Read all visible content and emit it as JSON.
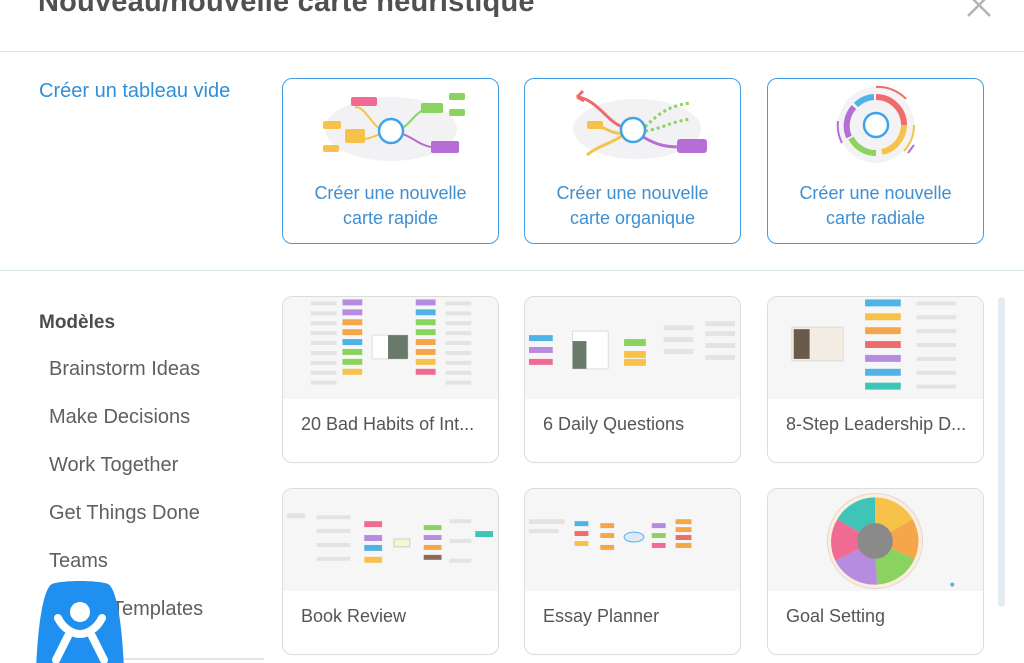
{
  "dialog": {
    "title": "Nouveau/nouvelle carte heuristique"
  },
  "create": {
    "blank_label": "Créer un tableau vide",
    "options": [
      {
        "line1": "Créer une nouvelle",
        "line2": "carte rapide"
      },
      {
        "line1": "Créer une nouvelle",
        "line2": "carte organique"
      },
      {
        "line1": "Créer une nouvelle",
        "line2": "carte radiale"
      }
    ]
  },
  "sidebar": {
    "heading": "Modèles",
    "items": [
      "Brainstorm Ideas",
      "Make Decisions",
      "Work Together",
      "Get Things Done",
      "Teams",
      "Expert Templates"
    ]
  },
  "templates": [
    {
      "name": "20 Bad Habits of Int..."
    },
    {
      "name": "6 Daily Questions"
    },
    {
      "name": "8-Step Leadership D..."
    },
    {
      "name": "Book Review"
    },
    {
      "name": "Essay Planner"
    },
    {
      "name": "Goal Setting"
    }
  ],
  "colors": {
    "accent": "#3f9ee6",
    "link": "#2f8fd8",
    "mascot": "#1f8ff0"
  },
  "icons": [
    "close-icon",
    "quick-map-icon",
    "organic-map-icon",
    "radial-map-icon",
    "mascot-logo"
  ]
}
